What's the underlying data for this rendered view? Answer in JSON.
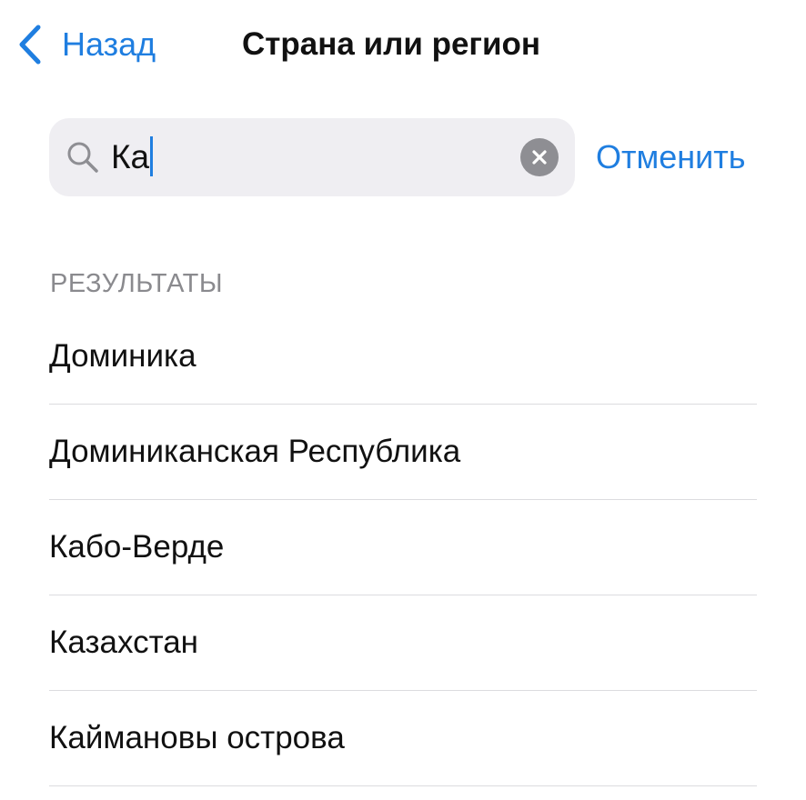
{
  "nav": {
    "back_label": "Назад",
    "title": "Страна или регион"
  },
  "search": {
    "value": "Ка",
    "cancel_label": "Отменить"
  },
  "results": {
    "header": "РЕЗУЛЬТАТЫ",
    "items": [
      {
        "label": "Доминика"
      },
      {
        "label": "Доминиканская Республика"
      },
      {
        "label": "Кабо-Верде"
      },
      {
        "label": "Казахстан"
      },
      {
        "label": "Каймановы острова"
      }
    ]
  },
  "icons": {
    "back": "chevron-left-icon",
    "search": "magnifier-icon",
    "clear": "clear-x-icon"
  },
  "colors": {
    "accent": "#1f7ee0",
    "search_bg": "#efeef2",
    "secondary_text": "#8a8a8e",
    "separator": "#dcdcdf"
  }
}
